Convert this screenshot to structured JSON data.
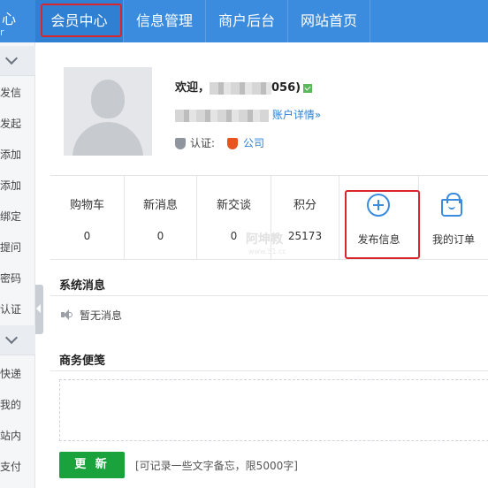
{
  "header": {
    "logo_glyph": "心",
    "logo_text": "r",
    "tabs": [
      {
        "label": "会员中心",
        "active": true
      },
      {
        "label": "信息管理"
      },
      {
        "label": "商户后台"
      },
      {
        "label": "网站首页"
      }
    ],
    "colors": {
      "bar": "#3b8cdf",
      "highlight": "#d9262a"
    }
  },
  "sidebar": {
    "items": [
      "发信",
      "发起",
      "添加",
      "添加",
      "绑定",
      "提问",
      "密码",
      "认证",
      "快递",
      "我的",
      "站内",
      "支付"
    ]
  },
  "profile": {
    "welcome_prefix": "欢迎，",
    "welcome_suffix": "056)",
    "account_link": "账户详情»",
    "auth_label": "认证:",
    "auth_company": "公司"
  },
  "stats": [
    {
      "label": "购物车",
      "value": "0"
    },
    {
      "label": "新消息",
      "value": "0"
    },
    {
      "label": "新交谈",
      "value": "0"
    },
    {
      "label": "积分",
      "value": "25173"
    }
  ],
  "actions": {
    "publish": "发布信息",
    "orders": "我的订单"
  },
  "watermark": {
    "text": "阿坤教",
    "sub": "www.51.cc"
  },
  "system_messages": {
    "title": "系统消息",
    "empty": "暂无消息"
  },
  "business_notes": {
    "title": "商务便笺",
    "button": "更 新",
    "hint": "[可记录一些文字备忘，限5000字]"
  }
}
